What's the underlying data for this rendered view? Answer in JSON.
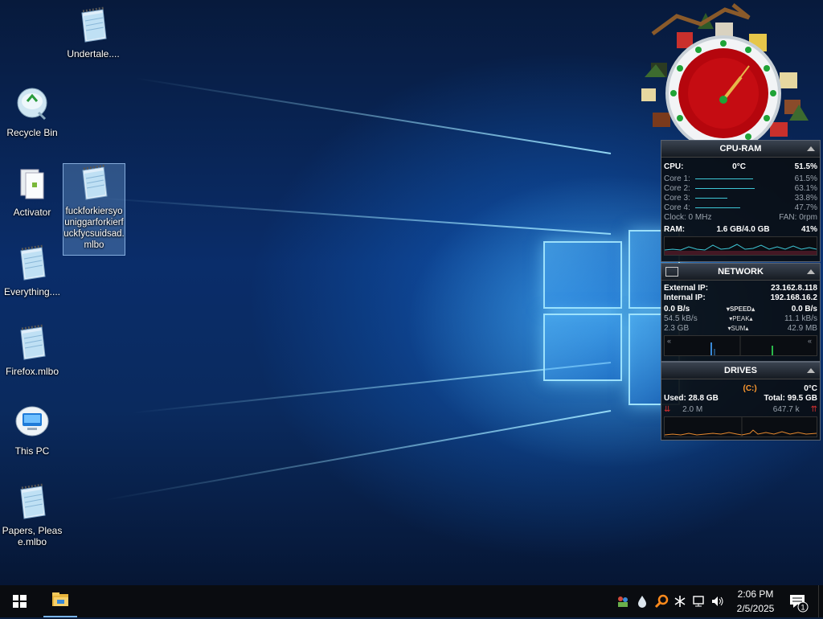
{
  "desktop": {
    "icons": [
      {
        "label": "Undertale...."
      },
      {
        "label": "Recycle Bin"
      },
      {
        "label": "Activator"
      },
      {
        "label": "fuckforkiersyouniggarforkierfuckfycsuidsad.mlbo"
      },
      {
        "label": "Everything...."
      },
      {
        "label": "Firefox.mlbo"
      },
      {
        "label": "This PC"
      },
      {
        "label": "Papers, Please.mlbo"
      }
    ]
  },
  "cpu_ram": {
    "title": "CPU-RAM",
    "cpu_label": "CPU:",
    "cpu_temp": "0°C",
    "cpu_usage": "51.5%",
    "cores": [
      {
        "label": "Core 1:",
        "value": "61.5%",
        "fraction": 0.615
      },
      {
        "label": "Core 2:",
        "value": "63.1%",
        "fraction": 0.631
      },
      {
        "label": "Core 3:",
        "value": "33.8%",
        "fraction": 0.338
      },
      {
        "label": "Core 4:",
        "value": "47.7%",
        "fraction": 0.477
      }
    ],
    "clock": "Clock: 0 MHz",
    "fan": "FAN: 0rpm",
    "ram_label": "RAM:",
    "ram_used": "1.6 GB/4.0 GB",
    "ram_pct": "41%"
  },
  "network": {
    "title": "NETWORK",
    "external_label": "External IP:",
    "external_ip": "23.162.8.118",
    "internal_label": "Internal IP:",
    "internal_ip": "192.168.16.2",
    "speed_down": "0.0 B/s",
    "speed_label": "SPEED",
    "speed_up": "0.0 B/s",
    "peak_down": "54.5 kB/s",
    "peak_label": "PEAK",
    "peak_up": "11.1 kB/s",
    "sum_down": "2.3 GB",
    "sum_label": "SUM",
    "sum_up": "42.9 MB"
  },
  "drives": {
    "title": "DRIVES",
    "drive_letter": "(C:)",
    "temp": "0°C",
    "used": "Used: 28.8 GB",
    "total": "Total: 99.5 GB",
    "read": "2.0 M",
    "write": "647.7 k"
  },
  "taskbar": {
    "time": "2:06 PM",
    "date": "2/5/2025",
    "notification_count": "1"
  },
  "colors": {
    "accent": "#3ec7d6",
    "taskbar": "#0a0c10",
    "drive_letter": "#ff9a2e"
  }
}
